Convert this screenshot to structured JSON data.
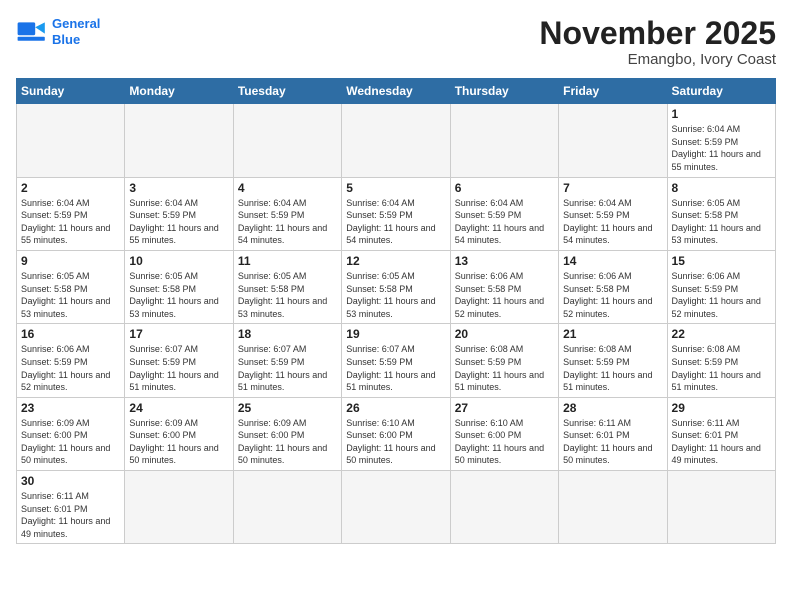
{
  "logo": {
    "line1": "General",
    "line2": "Blue"
  },
  "title": "November 2025",
  "location": "Emangbo, Ivory Coast",
  "days_of_week": [
    "Sunday",
    "Monday",
    "Tuesday",
    "Wednesday",
    "Thursday",
    "Friday",
    "Saturday"
  ],
  "weeks": [
    [
      {
        "day": "",
        "info": ""
      },
      {
        "day": "",
        "info": ""
      },
      {
        "day": "",
        "info": ""
      },
      {
        "day": "",
        "info": ""
      },
      {
        "day": "",
        "info": ""
      },
      {
        "day": "",
        "info": ""
      },
      {
        "day": "1",
        "info": "Sunrise: 6:04 AM\nSunset: 5:59 PM\nDaylight: 11 hours\nand 55 minutes."
      }
    ],
    [
      {
        "day": "2",
        "info": "Sunrise: 6:04 AM\nSunset: 5:59 PM\nDaylight: 11 hours\nand 55 minutes."
      },
      {
        "day": "3",
        "info": "Sunrise: 6:04 AM\nSunset: 5:59 PM\nDaylight: 11 hours\nand 55 minutes."
      },
      {
        "day": "4",
        "info": "Sunrise: 6:04 AM\nSunset: 5:59 PM\nDaylight: 11 hours\nand 54 minutes."
      },
      {
        "day": "5",
        "info": "Sunrise: 6:04 AM\nSunset: 5:59 PM\nDaylight: 11 hours\nand 54 minutes."
      },
      {
        "day": "6",
        "info": "Sunrise: 6:04 AM\nSunset: 5:59 PM\nDaylight: 11 hours\nand 54 minutes."
      },
      {
        "day": "7",
        "info": "Sunrise: 6:04 AM\nSunset: 5:59 PM\nDaylight: 11 hours\nand 54 minutes."
      },
      {
        "day": "8",
        "info": "Sunrise: 6:05 AM\nSunset: 5:58 PM\nDaylight: 11 hours\nand 53 minutes."
      }
    ],
    [
      {
        "day": "9",
        "info": "Sunrise: 6:05 AM\nSunset: 5:58 PM\nDaylight: 11 hours\nand 53 minutes."
      },
      {
        "day": "10",
        "info": "Sunrise: 6:05 AM\nSunset: 5:58 PM\nDaylight: 11 hours\nand 53 minutes."
      },
      {
        "day": "11",
        "info": "Sunrise: 6:05 AM\nSunset: 5:58 PM\nDaylight: 11 hours\nand 53 minutes."
      },
      {
        "day": "12",
        "info": "Sunrise: 6:05 AM\nSunset: 5:58 PM\nDaylight: 11 hours\nand 53 minutes."
      },
      {
        "day": "13",
        "info": "Sunrise: 6:06 AM\nSunset: 5:58 PM\nDaylight: 11 hours\nand 52 minutes."
      },
      {
        "day": "14",
        "info": "Sunrise: 6:06 AM\nSunset: 5:58 PM\nDaylight: 11 hours\nand 52 minutes."
      },
      {
        "day": "15",
        "info": "Sunrise: 6:06 AM\nSunset: 5:59 PM\nDaylight: 11 hours\nand 52 minutes."
      }
    ],
    [
      {
        "day": "16",
        "info": "Sunrise: 6:06 AM\nSunset: 5:59 PM\nDaylight: 11 hours\nand 52 minutes."
      },
      {
        "day": "17",
        "info": "Sunrise: 6:07 AM\nSunset: 5:59 PM\nDaylight: 11 hours\nand 51 minutes."
      },
      {
        "day": "18",
        "info": "Sunrise: 6:07 AM\nSunset: 5:59 PM\nDaylight: 11 hours\nand 51 minutes."
      },
      {
        "day": "19",
        "info": "Sunrise: 6:07 AM\nSunset: 5:59 PM\nDaylight: 11 hours\nand 51 minutes."
      },
      {
        "day": "20",
        "info": "Sunrise: 6:08 AM\nSunset: 5:59 PM\nDaylight: 11 hours\nand 51 minutes."
      },
      {
        "day": "21",
        "info": "Sunrise: 6:08 AM\nSunset: 5:59 PM\nDaylight: 11 hours\nand 51 minutes."
      },
      {
        "day": "22",
        "info": "Sunrise: 6:08 AM\nSunset: 5:59 PM\nDaylight: 11 hours\nand 51 minutes."
      }
    ],
    [
      {
        "day": "23",
        "info": "Sunrise: 6:09 AM\nSunset: 6:00 PM\nDaylight: 11 hours\nand 50 minutes."
      },
      {
        "day": "24",
        "info": "Sunrise: 6:09 AM\nSunset: 6:00 PM\nDaylight: 11 hours\nand 50 minutes."
      },
      {
        "day": "25",
        "info": "Sunrise: 6:09 AM\nSunset: 6:00 PM\nDaylight: 11 hours\nand 50 minutes."
      },
      {
        "day": "26",
        "info": "Sunrise: 6:10 AM\nSunset: 6:00 PM\nDaylight: 11 hours\nand 50 minutes."
      },
      {
        "day": "27",
        "info": "Sunrise: 6:10 AM\nSunset: 6:00 PM\nDaylight: 11 hours\nand 50 minutes."
      },
      {
        "day": "28",
        "info": "Sunrise: 6:11 AM\nSunset: 6:01 PM\nDaylight: 11 hours\nand 50 minutes."
      },
      {
        "day": "29",
        "info": "Sunrise: 6:11 AM\nSunset: 6:01 PM\nDaylight: 11 hours\nand 49 minutes."
      }
    ],
    [
      {
        "day": "30",
        "info": "Sunrise: 6:11 AM\nSunset: 6:01 PM\nDaylight: 11 hours\nand 49 minutes."
      },
      {
        "day": "",
        "info": ""
      },
      {
        "day": "",
        "info": ""
      },
      {
        "day": "",
        "info": ""
      },
      {
        "day": "",
        "info": ""
      },
      {
        "day": "",
        "info": ""
      },
      {
        "day": "",
        "info": ""
      }
    ]
  ]
}
